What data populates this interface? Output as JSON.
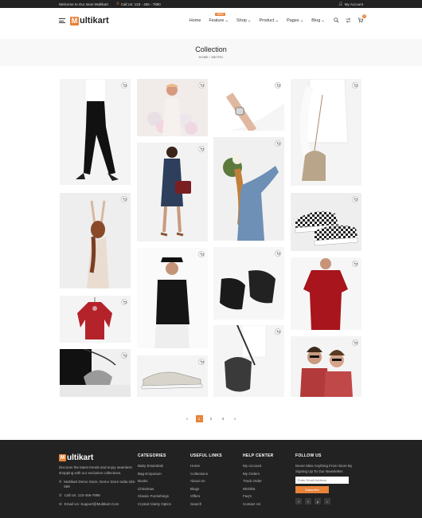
{
  "topbar": {
    "welcome": "Welcome to Our store Multikart",
    "phone": "Call Us: 123 - 456 - 7890",
    "account": "My Account"
  },
  "brand": {
    "logo_letter": "M",
    "logo_rest": "ultikart"
  },
  "nav": {
    "home": "Home",
    "feature": "Feature",
    "feature_badge": "NEW",
    "shop": "Shop",
    "product": "Product",
    "pages": "Pages",
    "blog": "Blog"
  },
  "cart": {
    "count": "0"
  },
  "page": {
    "title": "Collection",
    "breadcrumb": "HOME / METRO"
  },
  "pagination": {
    "prev": "«",
    "pages": [
      "1",
      "2",
      "3"
    ],
    "next": "»",
    "active": "1"
  },
  "footer": {
    "about": "Discover the latest trends and enjoy seamless shopping with our exclusive collections.",
    "address": "Multikart Demo Store, Demo Store India 345-659",
    "phone": "Call Us: 123-456-7898",
    "email": "Email Us: Support@Multikart.Com",
    "categories_title": "CATEGORIES",
    "categories": [
      "Baby Essentials",
      "Bag Emporium",
      "Books",
      "Christmas",
      "Classic Furnishings",
      "Crystal Clarity Optics"
    ],
    "links_title": "USEFUL LINKS",
    "links": [
      "Home",
      "Collections",
      "About Us",
      "Blogs",
      "Offers",
      "Search"
    ],
    "help_title": "HELP CENTER",
    "help": [
      "My Account",
      "My Orders",
      "Track Order",
      "Wishlist",
      "Faq's",
      "Contact Us"
    ],
    "follow_title": "FOLLOW US",
    "follow_text": "Never Miss Anything From Store By Signing Up To Our Newsletter.",
    "email_placeholder": "Enter Email Address",
    "subscribe": "Subscribe",
    "socials": [
      "f",
      "t",
      "p",
      "i"
    ]
  },
  "products": [
    {
      "name": "black-trousers",
      "icon": "cart-icon"
    },
    {
      "name": "woman-balloons",
      "icon": "cart-icon"
    },
    {
      "name": "wrist-watch",
      "icon": "cart-icon"
    },
    {
      "name": "woman-handbag",
      "icon": "cart-icon"
    },
    {
      "name": "woman-denim-dress",
      "icon": "cart-icon"
    },
    {
      "name": "woman-flowers-sweater",
      "icon": "cart-icon"
    },
    {
      "name": "woman-beige-dress",
      "icon": "cart-icon"
    },
    {
      "name": "checkered-sneakers",
      "icon": "cart-icon"
    },
    {
      "name": "man-black-tshirt",
      "icon": "cart-icon"
    },
    {
      "name": "black-slides",
      "icon": "cart-icon"
    },
    {
      "name": "red-tshirt",
      "icon": "cart-icon"
    },
    {
      "name": "red-blouse",
      "icon": "cart-icon"
    },
    {
      "name": "grey-sneakers",
      "icon": "cart-icon"
    },
    {
      "name": "shoulder-bag",
      "icon": "cart-icon"
    },
    {
      "name": "crossbody-bag",
      "icon": "cart-icon"
    },
    {
      "name": "two-women-sunglasses",
      "icon": "cart-icon"
    }
  ]
}
